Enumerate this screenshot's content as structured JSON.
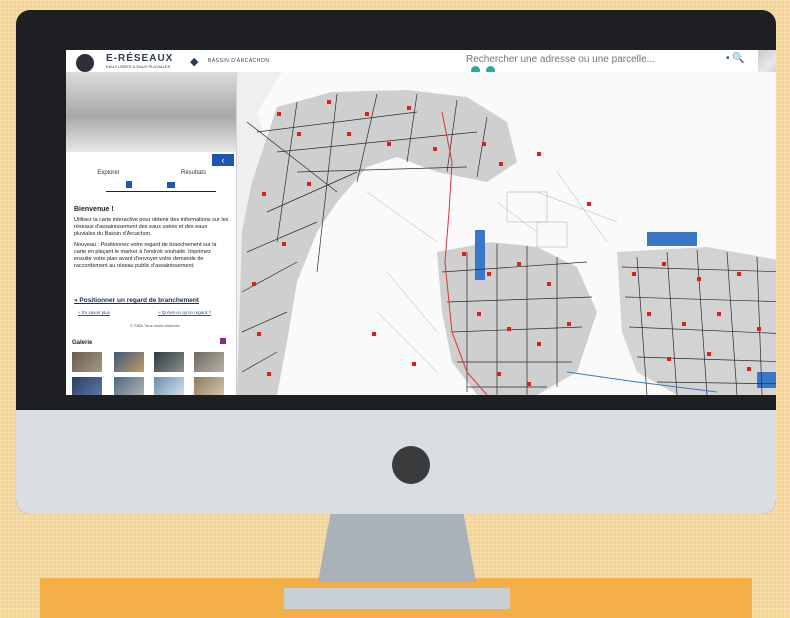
{
  "header": {
    "app_title": "E-RÉSEAUX",
    "app_subtitle": "EAUX USÉES & EAUX PLUVIALES",
    "bassin_label": "BASSIN D'ARCACHON",
    "search_placeholder": "Rechercher une adresse ou une parcelle..."
  },
  "sidebar": {
    "collapse_label": "‹",
    "tabs": [
      {
        "label": "Explorer"
      },
      {
        "label": "Résultats"
      }
    ],
    "welcome_title": "Bienvenue !",
    "welcome_p1": "Utilisez la carte interactive pour obtenir des informations sur les réseaux d'assainissement des eaux usées et des eaux pluviales du Bassin d'Arcachon.",
    "welcome_p2": "Nouveau : Positionnez votre regard de branchement sur la carte en plaçant le marker à l'endroit souhaité. Imprimez ensuite votre plan avant d'envoyer votre demande de raccordement au réseau public d'assainissement.",
    "cta": "»  Positionner un regard de branchement",
    "link1": "» En savoir plus",
    "link2": "» Qu'est-ce qu'un regard ?",
    "footer": "© SIBA Tous droits réservés",
    "gallery_title": "Galerie"
  },
  "map_controls": [
    "+",
    "−",
    "⌂",
    "◉",
    "◐",
    "⬍",
    "<"
  ],
  "colors": {
    "accent": "#1f56b1",
    "teal": "#2ba99c",
    "marker": "#e21b1b",
    "monitor": "#1d1f22",
    "background": "#f6d493"
  }
}
